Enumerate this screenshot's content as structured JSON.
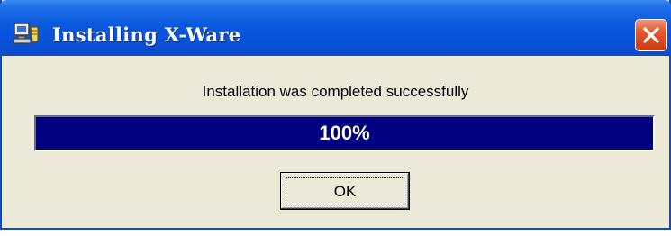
{
  "window": {
    "title": "Installing X-Ware",
    "app_icon": "installer-computer-icon",
    "close_icon": "close-icon",
    "title_bar_color": "#0a58de",
    "background_color": "#ece9d8"
  },
  "dialog": {
    "message": "Installation was completed successfully",
    "progress": {
      "value": 1.0,
      "label": "100%",
      "fill_color": "#000080"
    },
    "ok_button": {
      "label": "OK"
    }
  }
}
